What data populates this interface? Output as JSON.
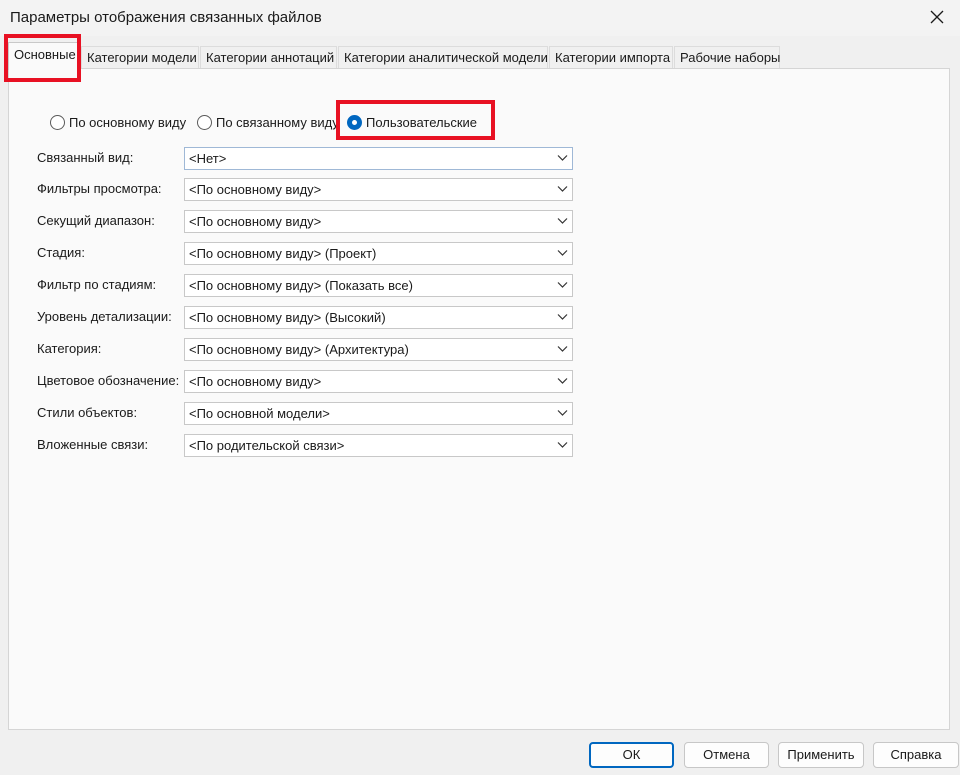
{
  "window": {
    "title": "Параметры отображения связанных файлов",
    "close_icon": "close-icon"
  },
  "tabs": [
    {
      "label": "Основные",
      "active": true
    },
    {
      "label": "Категории модели",
      "active": false
    },
    {
      "label": "Категории аннотаций",
      "active": false
    },
    {
      "label": "Категории аналитической модели",
      "active": false
    },
    {
      "label": "Категории импорта",
      "active": false
    },
    {
      "label": "Рабочие наборы",
      "active": false
    }
  ],
  "view_mode": {
    "options": [
      {
        "label": "По основному виду",
        "checked": false
      },
      {
        "label": "По связанному виду",
        "checked": false
      },
      {
        "label": "Пользовательские",
        "checked": true
      }
    ]
  },
  "settings": [
    {
      "label": "Связанный вид:",
      "value": "<Нет>"
    },
    {
      "label": "Фильтры просмотра:",
      "value": "<По основному виду>"
    },
    {
      "label": "Секущий диапазон:",
      "value": "<По основному виду>"
    },
    {
      "label": "Стадия:",
      "value": "<По основному виду> (Проект)"
    },
    {
      "label": "Фильтр по стадиям:",
      "value": "<По основному виду> (Показать все)"
    },
    {
      "label": "Уровень детализации:",
      "value": "<По основному виду> (Высокий)"
    },
    {
      "label": "Категория:",
      "value": "<По основному виду> (Архитектура)"
    },
    {
      "label": "Цветовое обозначение:",
      "value": "<По основному виду>"
    },
    {
      "label": "Стили объектов:",
      "value": "<По основной модели>"
    },
    {
      "label": "Вложенные связи:",
      "value": "<По родительской связи>"
    }
  ],
  "buttons": {
    "ok": "ОК",
    "cancel": "Отмена",
    "apply": "Применить",
    "help": "Справка"
  },
  "colors": {
    "accent": "#0067c0",
    "highlight": "#e81123"
  }
}
